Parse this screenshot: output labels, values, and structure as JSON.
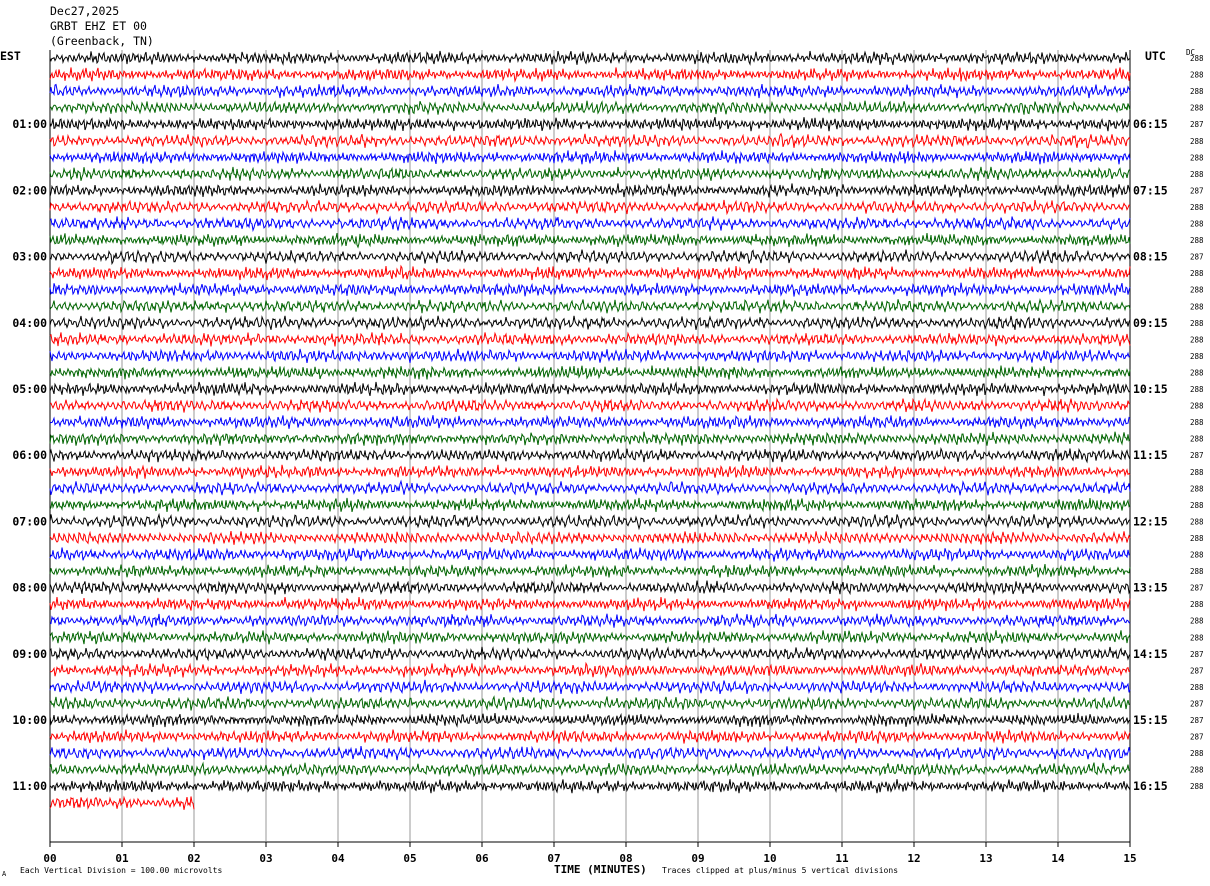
{
  "header": {
    "date": "Dec27,2025",
    "station": "GRBT EHZ ET 00",
    "location": "(Greenback, TN)"
  },
  "left_timezone": "EST",
  "right_timezone": "UTC",
  "dc_label": "DC",
  "footer": {
    "scale_note": "Each Vertical Division =  100.00 microvolts",
    "clip_note": "Traces clipped at plus/minus 5 vertical divisions",
    "corner_mark": "A"
  },
  "chart_data": {
    "type": "line",
    "xlabel": "TIME (MINUTES)",
    "xlim": [
      0,
      15
    ],
    "x_ticks": [
      "00",
      "01",
      "02",
      "03",
      "04",
      "05",
      "06",
      "07",
      "08",
      "09",
      "10",
      "11",
      "12",
      "13",
      "14",
      "15"
    ],
    "grid": "vertical lines at each minute",
    "trace_colors": [
      "#000000",
      "#ff0000",
      "#0000ff",
      "#006400"
    ],
    "traces_per_hour": 4,
    "minutes_per_trace": 15,
    "hour_labels_left": [
      "01:00",
      "02:00",
      "03:00",
      "04:00",
      "05:00",
      "06:00",
      "07:00",
      "08:00",
      "09:00",
      "10:00",
      "11:00"
    ],
    "hour_labels_right": [
      "06:15",
      "07:15",
      "08:15",
      "09:15",
      "10:15",
      "11:15",
      "12:15",
      "13:15",
      "14:15",
      "15:15",
      "16:15"
    ],
    "dc_offsets": [
      "288",
      "288",
      "288",
      "288",
      "287",
      "288",
      "288",
      "288",
      "287",
      "288",
      "288",
      "288",
      "287",
      "288",
      "288",
      "288",
      "288",
      "288",
      "288",
      "288",
      "288",
      "288",
      "288",
      "288",
      "287",
      "288",
      "288",
      "288",
      "288",
      "288",
      "288",
      "288",
      "287",
      "288",
      "288",
      "288",
      "287",
      "287",
      "288",
      "287",
      "287",
      "287",
      "288",
      "288",
      "288"
    ],
    "last_trace_minutes": 2
  }
}
